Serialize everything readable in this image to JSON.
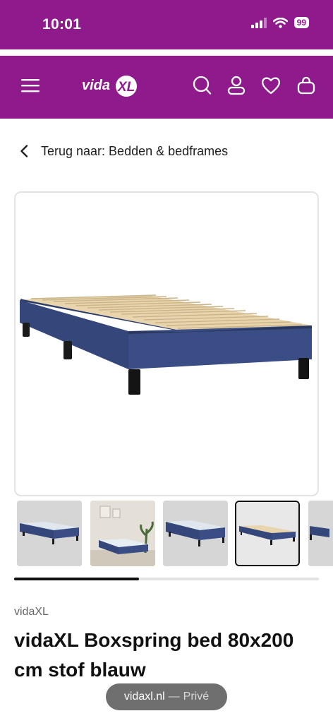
{
  "status_bar": {
    "time": "10:01",
    "battery": "99",
    "icons": [
      "signal-icon",
      "wifi-icon",
      "battery-icon"
    ]
  },
  "header": {
    "logo_text": "vidaXL",
    "icons": [
      "menu-icon",
      "search-icon",
      "account-icon",
      "wishlist-icon",
      "cart-icon"
    ],
    "brand_color": "#8e1a8c"
  },
  "breadcrumb": {
    "label": "Terug naar: Bedden & bedframes"
  },
  "gallery": {
    "thumbnail_count": 5,
    "selected_index": 3,
    "scroll_progress": 0.41
  },
  "product": {
    "brand": "vidaXL",
    "title": "vidaXL Boxspring bed 80x200 cm stof blauw"
  },
  "browser": {
    "url": "vidaxl.nl",
    "separator": "—",
    "mode": "Privé"
  }
}
